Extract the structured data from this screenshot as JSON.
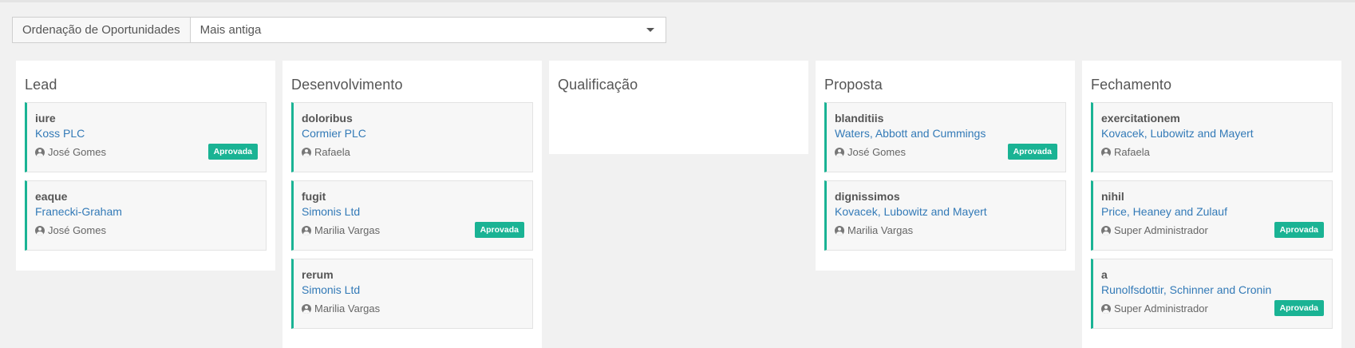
{
  "sort": {
    "label": "Ordenação de Oportunidades",
    "selected": "Mais antiga"
  },
  "columns": [
    {
      "title": "Lead",
      "cards": [
        {
          "title": "iure",
          "company": "Koss PLC",
          "owner": "José Gomes",
          "badge": "Aprovada"
        },
        {
          "title": "eaque",
          "company": "Franecki-Graham",
          "owner": "José Gomes",
          "badge": ""
        }
      ]
    },
    {
      "title": "Desenvolvimento",
      "cards": [
        {
          "title": "doloribus",
          "company": "Cormier PLC",
          "owner": "Rafaela",
          "badge": ""
        },
        {
          "title": "fugit",
          "company": "Simonis Ltd",
          "owner": "Marilia Vargas",
          "badge": "Aprovada"
        },
        {
          "title": "rerum",
          "company": "Simonis Ltd",
          "owner": "Marilia Vargas",
          "badge": ""
        }
      ]
    },
    {
      "title": "Qualificação",
      "cards": []
    },
    {
      "title": "Proposta",
      "cards": [
        {
          "title": "blanditiis",
          "company": "Waters, Abbott and Cummings",
          "owner": "José Gomes",
          "badge": "Aprovada"
        },
        {
          "title": "dignissimos",
          "company": "Kovacek, Lubowitz and Mayert",
          "owner": "Marilia Vargas",
          "badge": ""
        }
      ]
    },
    {
      "title": "Fechamento",
      "cards": [
        {
          "title": "exercitationem",
          "company": "Kovacek, Lubowitz and Mayert",
          "owner": "Rafaela",
          "badge": ""
        },
        {
          "title": "nihil",
          "company": "Price, Heaney and Zulauf",
          "owner": "Super Administrador",
          "badge": "Aprovada"
        },
        {
          "title": "a",
          "company": "Runolfsdottir, Schinner and Cronin",
          "owner": "Super Administrador",
          "badge": "Aprovada"
        }
      ]
    }
  ],
  "colors": {
    "accent": "#1ab394",
    "link": "#337ab7"
  },
  "icons": {
    "owner": "user-circle-icon",
    "dropdown": "caret-down-icon"
  }
}
